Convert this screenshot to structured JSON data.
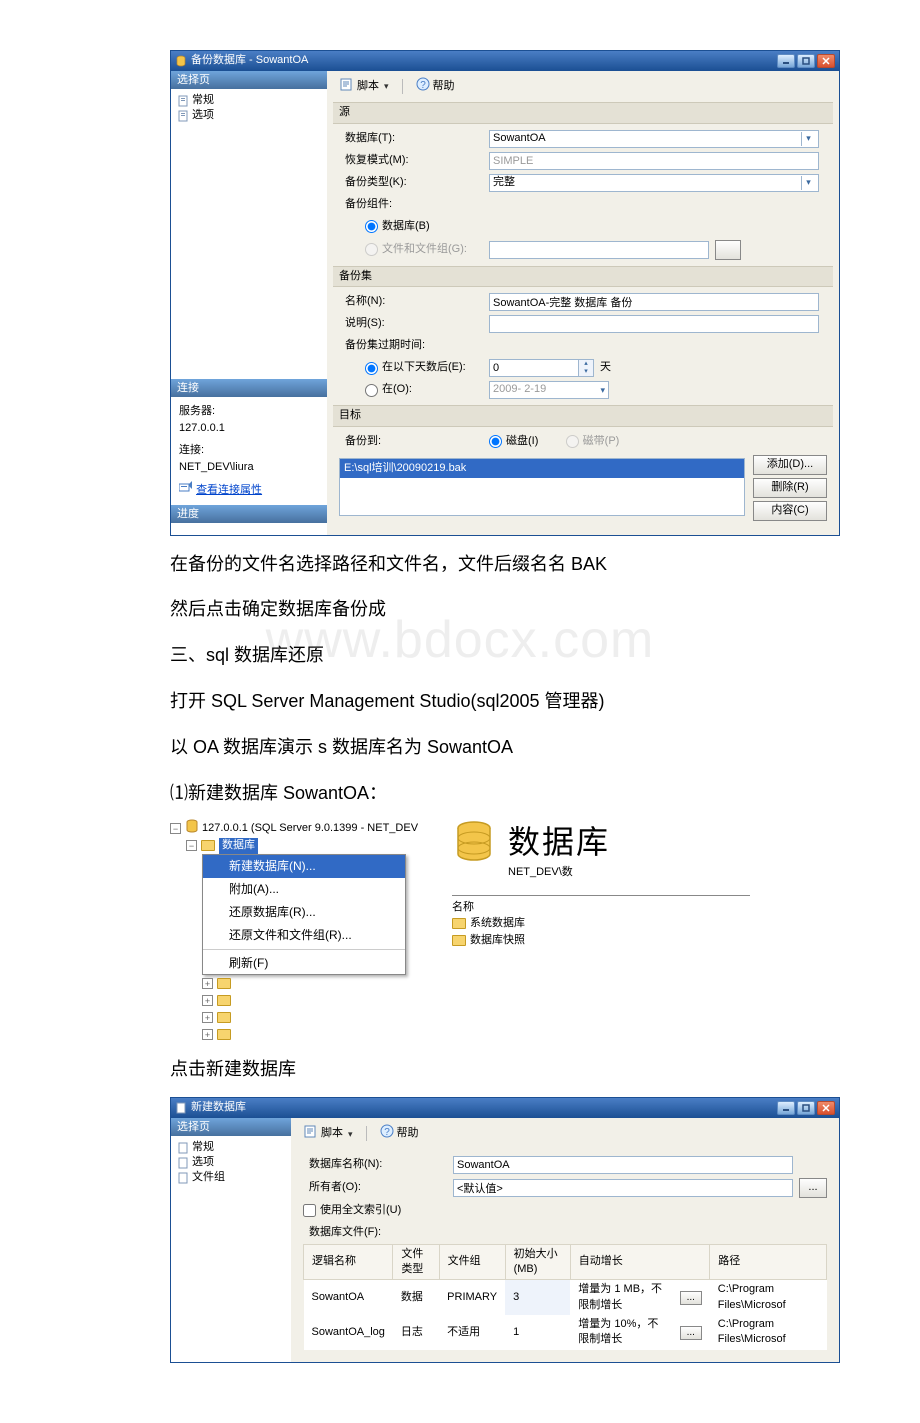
{
  "dialog1": {
    "title": "备份数据库 - SowantOA",
    "left": {
      "selectPage": "选择页",
      "items": [
        "常规",
        "选项"
      ],
      "connection": "连接",
      "serverLbl": "服务器:",
      "server": "127.0.0.1",
      "connLbl": "连接:",
      "conn": "NET_DEV\\liura",
      "viewLink": "查看连接属性",
      "progress": "进度"
    },
    "toolbar": {
      "script": "脚本",
      "help": "帮助"
    },
    "source": {
      "group": "源",
      "databaseLbl": "数据库(T):",
      "database": "SowantOA",
      "recoveryModeLbl": "恢复模式(M):",
      "recoveryMode": "SIMPLE",
      "backupTypeLbl": "备份类型(K):",
      "backupType": "完整",
      "componentLbl": "备份组件:",
      "radioDb": "数据库(B)",
      "radioFg": "文件和文件组(G):"
    },
    "backupSet": {
      "group": "备份集",
      "nameLbl": "名称(N):",
      "name": "SowantOA-完整 数据库 备份",
      "descLbl": "说明(S):",
      "desc": "",
      "expireLbl": "备份集过期时间:",
      "afterDaysLbl": "在以下天数后(E):",
      "days": "0",
      "daysUnit": "天",
      "onLbl": "在(O):",
      "date": "2009- 2-19"
    },
    "dest": {
      "group": "目标",
      "toLbl": "备份到:",
      "radioDisk": "磁盘(I)",
      "radioTape": "磁带(P)",
      "file": "E:\\sql培训\\20090219.bak",
      "addBtn": "添加(D)...",
      "removeBtn": "删除(R)",
      "contentsBtn": "内容(C)"
    }
  },
  "doc": {
    "p1": "在备份的文件名选择路径和文件名，文件后缀名名 BAK",
    "p2": "然后点击确定数据库备份成",
    "p3": "三、sql 数据库还原",
    "p4": "打开 SQL Server Management Studio(sql2005 管理器)",
    "p5": "以 OA 数据库演示 s 数据库名为 SowantOA",
    "p6": "⑴新建数据库 SowantOA：",
    "p7": "点击新建数据库"
  },
  "watermark": "www.bdocx.com",
  "shot2": {
    "root": "127.0.0.1 (SQL Server 9.0.1399 - NET_DEV",
    "dbNode": "数据库",
    "menuItems": [
      "新建数据库(N)...",
      "附加(A)...",
      "还原数据库(R)...",
      "还原文件和文件组(R)...",
      "刷新(F)"
    ],
    "rTitle": "数据库",
    "rSub": "NET_DEV\\数",
    "nameHdr": "名称",
    "rows": [
      "系统数据库",
      "数据库快照"
    ]
  },
  "dialog2": {
    "title": "新建数据库",
    "left": {
      "selectPage": "选择页",
      "items": [
        "常规",
        "选项",
        "文件组"
      ]
    },
    "toolbar": {
      "script": "脚本",
      "help": "帮助"
    },
    "fields": {
      "dbNameLbl": "数据库名称(N):",
      "dbName": "SowantOA",
      "ownerLbl": "所有者(O):",
      "owner": "<默认值>",
      "fulltext": "使用全文索引(U)",
      "filesLbl": "数据库文件(F):"
    },
    "table": {
      "headers": [
        "逻辑名称",
        "文件类型",
        "文件组",
        "初始大小(MB)",
        "自动增长",
        "",
        "路径"
      ],
      "rows": [
        [
          "SowantOA",
          "数据",
          "PRIMARY",
          "3",
          "增量为 1 MB，不限制增长",
          "...",
          "C:\\Program Files\\Microsof"
        ],
        [
          "SowantOA_log",
          "日志",
          "不适用",
          "1",
          "增量为 10%，不限制增长",
          "...",
          "C:\\Program Files\\Microsof"
        ]
      ]
    }
  }
}
